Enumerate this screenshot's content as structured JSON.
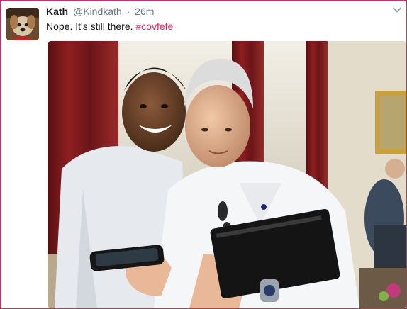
{
  "tweet": {
    "display_name": "Kath",
    "handle": "@Kindkath",
    "separator": "·",
    "timestamp": "26m",
    "text": "Nope. It's still there.",
    "hashtag": "#covfefe"
  },
  "icons": {
    "menu": "chevron-down-icon",
    "avatar": "dog-avatar"
  },
  "colors": {
    "accent": "#e0245e",
    "text": "#14171a",
    "muted": "#657786"
  }
}
